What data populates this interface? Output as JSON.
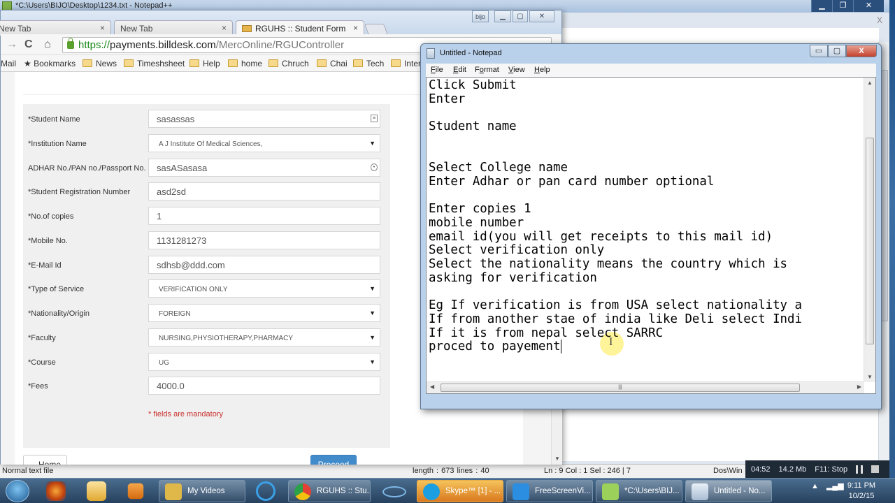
{
  "notepadpp": {
    "title": "*C:\\Users\\BIJO\\Desktop\\1234.txt - Notepad++",
    "window_controls": [
      "minimize",
      "restore",
      "close"
    ],
    "close_label": "X",
    "status": {
      "file_type": "Normal text file",
      "length_lines": "length : 673    lines : 40",
      "position": "Ln : 9    Col : 1    Sel : 246 | 7",
      "eol": "Dos\\Win"
    }
  },
  "recorder": {
    "time": "04:52",
    "size": "14.2 Mb",
    "hotkey": "F11: Stop"
  },
  "browser": {
    "tabs": [
      {
        "label": "New Tab",
        "close": "×",
        "active": false
      },
      {
        "label": "New Tab",
        "close": "×",
        "active": false
      },
      {
        "label": "RGUHS :: Student Form",
        "close": "×",
        "active": true
      }
    ],
    "badge": "bijo",
    "url": {
      "scheme": "https://",
      "domain": "payments.billdesk.com",
      "path": "/MercOnline/RGUController"
    },
    "nav": {
      "back": "←",
      "forward": "→",
      "reload": "C",
      "home": "⌂"
    },
    "bookmarks": [
      "Mail",
      "Bookmarks",
      "News",
      "Timeshsheet",
      "Help",
      "home",
      "Chruch",
      "Chai",
      "Tech",
      "Inter"
    ]
  },
  "form": {
    "fields": [
      {
        "label": "*Student Name",
        "value": "sasassas",
        "type": "text",
        "icon": "contact-card-icon"
      },
      {
        "label": "*Institution Name",
        "value": "A J Institute Of Medical Sciences,",
        "type": "select"
      },
      {
        "label": "ADHAR No./PAN no./Passport No.",
        "value": "sasASasasa",
        "type": "text",
        "icon": "key-icon"
      },
      {
        "label": "*Student Registration Number",
        "value": "asd2sd",
        "type": "text"
      },
      {
        "label": "*No.of copies",
        "value": "1",
        "type": "text"
      },
      {
        "label": "*Mobile No.",
        "value": "1131281273",
        "type": "text"
      },
      {
        "label": "*E-Mail Id",
        "value": "sdhsb@ddd.com",
        "type": "text"
      },
      {
        "label": "*Type of Service",
        "value": "VERIFICATION ONLY",
        "type": "select"
      },
      {
        "label": "*Nationality/Origin",
        "value": "FOREIGN",
        "type": "select"
      },
      {
        "label": "*Faculty",
        "value": "NURSING,PHYSIOTHERAPY,PHARMACY",
        "type": "select"
      },
      {
        "label": "*Course",
        "value": "UG",
        "type": "select"
      },
      {
        "label": "*Fees",
        "value": "4000.0",
        "type": "text"
      }
    ],
    "mandatory_note": "* fields are mandatory",
    "home_button": "←Home",
    "proceed_button": "Proceed",
    "accent_color": "#428bca"
  },
  "notepad": {
    "title": "Untitled - Notepad",
    "close_label": "X",
    "menu": [
      {
        "key": "F",
        "rest": "ile"
      },
      {
        "key": "E",
        "rest": "dit"
      },
      {
        "pre": "F",
        "key": "o",
        "rest": "rmat"
      },
      {
        "key": "V",
        "rest": "iew"
      },
      {
        "key": "H",
        "rest": "elp"
      }
    ],
    "text": "Click Submit\nEnter\n\nStudent name\n\n\nSelect College name\nEnter Adhar or pan card number optional\n\nEnter copies 1\nmobile number\nemail id(you will get receipts to this mail id)\nSelect verification only\nSelect the nationality means the country which is\nasking for verification\n\nEg If verification is from USA select nationality a\nIf from another stae of india like Deli select Indi\nIf it is from nepal select SARRC\nproced to payement"
  },
  "taskbar": {
    "items": [
      {
        "label": "My Videos",
        "icon": "folder-video-icon"
      },
      {
        "label": "RGUHS :: Stu...",
        "icon": "chrome-icon"
      },
      {
        "label": "Skype™ [1] - ...",
        "icon": "skype-icon"
      },
      {
        "label": "FreeScreenVi...",
        "icon": "screen-recorder-icon"
      },
      {
        "label": "*C:\\Users\\BIJ...",
        "icon": "notepadpp-icon"
      },
      {
        "label": "Untitled - No...",
        "icon": "notepad-icon"
      }
    ],
    "clock": {
      "time": "9:11 PM",
      "date": "10/2/15"
    }
  }
}
